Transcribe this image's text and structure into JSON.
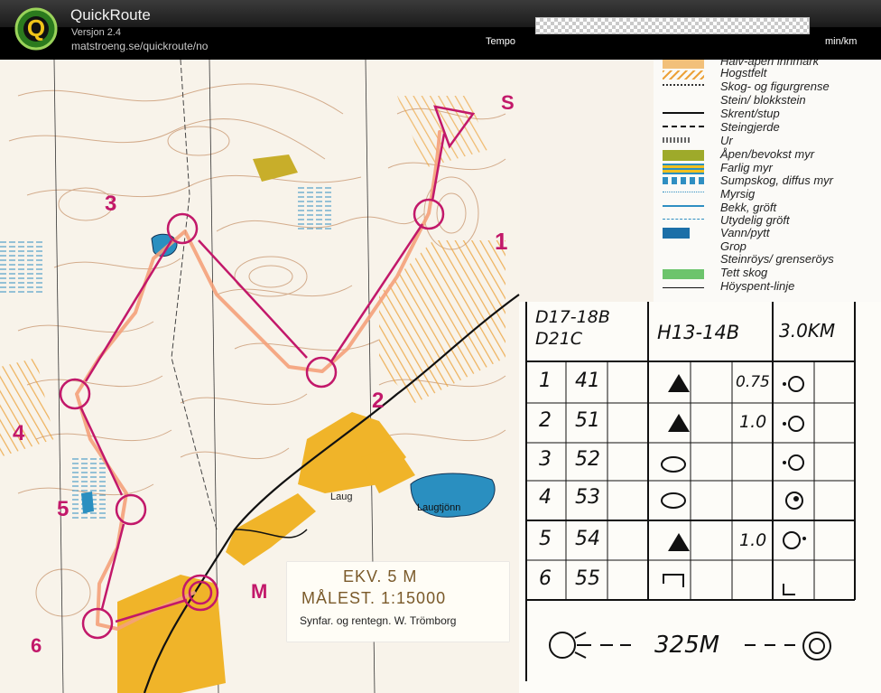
{
  "app": {
    "title": "QuickRoute",
    "version": "Versjon 2.4",
    "url": "matstroeng.se/quickroute/no",
    "logo_letter": "Q"
  },
  "toolbar": {
    "tempo_label": "Tempo",
    "tempo_unit": "min/km"
  },
  "map": {
    "control_labels": [
      "1",
      "2",
      "3",
      "4",
      "5",
      "6",
      "S",
      "M"
    ],
    "lake_label": "Laugtjönn",
    "place_label": "Laug",
    "scale_info": {
      "equidistance": "EKV. 5 M",
      "scale": "MÅLEST. 1:15000",
      "credit": "Synfar. og rentegn. W. Trömborg"
    },
    "colors": {
      "course_line": "#c2186a",
      "route_line": "#f4a17a",
      "water": "#2a8fc0",
      "yellow": "#f0b429"
    }
  },
  "legend": {
    "items": [
      "Halv-åpen innmark",
      "Hogstfelt",
      "Skog- og figurgrense",
      "Stein/ blokkstein",
      "Skrent/stup",
      "Steingjerde",
      "Ur",
      "Åpen/bevokst myr",
      "Farlig myr",
      "Sumpskog, diffus myr",
      "Myrsig",
      "Bekk, gröft",
      "Utydelig gröft",
      "Vann/pytt",
      "Grop",
      "Steinröys/ grenseröys",
      "Tett skog",
      "Höyspent-linje"
    ]
  },
  "course_card": {
    "classes_left_1": "D17-18B",
    "classes_left_2": "D21C",
    "classes_mid": "H13-14B",
    "length": "3.0KM",
    "rows": [
      {
        "num": "1",
        "code": "41",
        "size": "0.75"
      },
      {
        "num": "2",
        "code": "51",
        "size": "1.0"
      },
      {
        "num": "3",
        "code": "52",
        "size": ""
      },
      {
        "num": "4",
        "code": "53",
        "size": ""
      },
      {
        "num": "5",
        "code": "54",
        "size": "1.0"
      },
      {
        "num": "6",
        "code": "55",
        "size": ""
      }
    ],
    "finish_distance": "325M"
  }
}
